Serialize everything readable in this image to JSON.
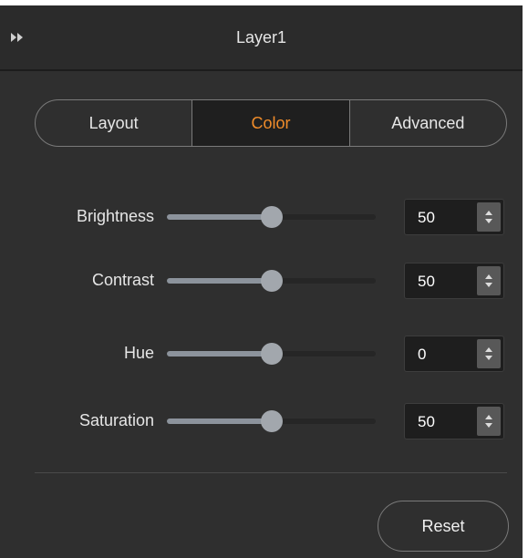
{
  "header": {
    "title": "Layer1",
    "collapse_icon": "double-chevron-right-icon"
  },
  "tabs": [
    {
      "label": "Layout",
      "active": false
    },
    {
      "label": "Color",
      "active": true
    },
    {
      "label": "Advanced",
      "active": false
    }
  ],
  "controls": [
    {
      "label": "Brightness",
      "value": "50",
      "slider_position": 0.5
    },
    {
      "label": "Contrast",
      "value": "50",
      "slider_position": 0.5
    },
    {
      "label": "Hue",
      "value": "0",
      "slider_position": 0.5
    },
    {
      "label": "Saturation",
      "value": "50",
      "slider_position": 0.5
    }
  ],
  "footer": {
    "reset_label": "Reset"
  },
  "colors": {
    "panel_background": "#2f2f2f",
    "active_tab_text": "#f08c2a",
    "slider_fill": "#8c939c",
    "slider_knob": "#a2a7ad"
  }
}
